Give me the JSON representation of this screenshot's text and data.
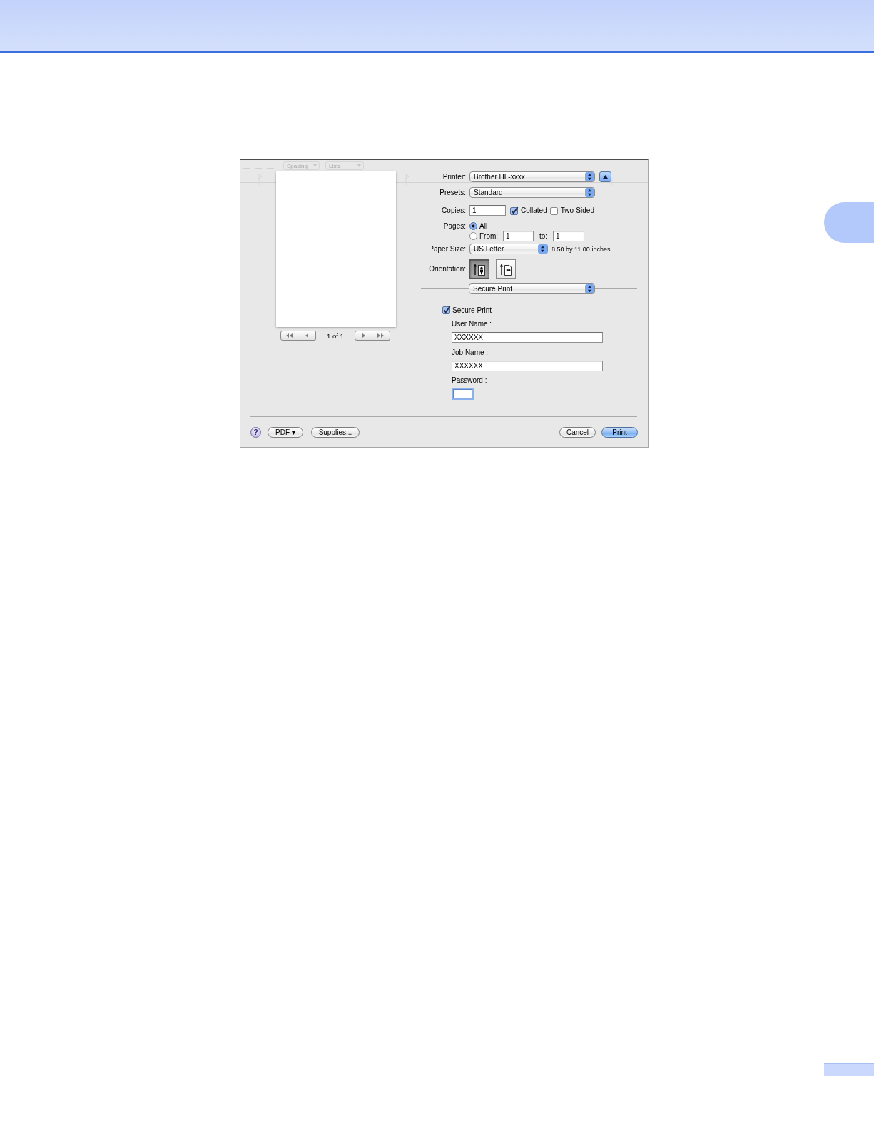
{
  "background_toolbar": {
    "dropdowns": [
      "Spacing",
      "Lists"
    ]
  },
  "preview": {
    "page_indicator": "1 of 1"
  },
  "printer": {
    "label": "Printer:",
    "value": "Brother HL-xxxx",
    "expanded": true
  },
  "presets": {
    "label": "Presets:",
    "value": "Standard"
  },
  "copies": {
    "label": "Copies:",
    "value": "1",
    "options": [
      {
        "label": "Collated",
        "checked": true
      },
      {
        "label": "Two-Sided",
        "checked": false
      }
    ]
  },
  "pages": {
    "label": "Pages:",
    "choices": [
      {
        "kind": "all",
        "label": "All",
        "selected": true
      },
      {
        "kind": "range",
        "label": "From:",
        "selected": false,
        "from": "1",
        "to_label": "to:",
        "to": "1"
      }
    ]
  },
  "paper_size": {
    "label": "Paper Size:",
    "value": "US Letter",
    "dimensions": "8.50 by 11.00 inches"
  },
  "orientation": {
    "label": "Orientation:",
    "options": [
      {
        "kind": "portrait",
        "selected": true
      },
      {
        "kind": "landscape",
        "selected": false
      }
    ]
  },
  "panel_menu": {
    "value": "Secure Print"
  },
  "secure_print": {
    "label": "Secure Print",
    "checked": true,
    "fields": [
      {
        "kind": "text",
        "label": "User Name :",
        "value": "XXXXXX",
        "focused": false
      },
      {
        "kind": "text",
        "label": "Job Name :",
        "value": "XXXXXX",
        "focused": false
      },
      {
        "kind": "password",
        "label": "Password :",
        "focused": true
      }
    ]
  },
  "footer": {
    "help_button": "?",
    "left_buttons": [
      "PDF ▾",
      "Supplies..."
    ],
    "right_buttons": [
      {
        "label": "Cancel",
        "default": false
      },
      {
        "label": "Print",
        "default": true
      }
    ]
  }
}
